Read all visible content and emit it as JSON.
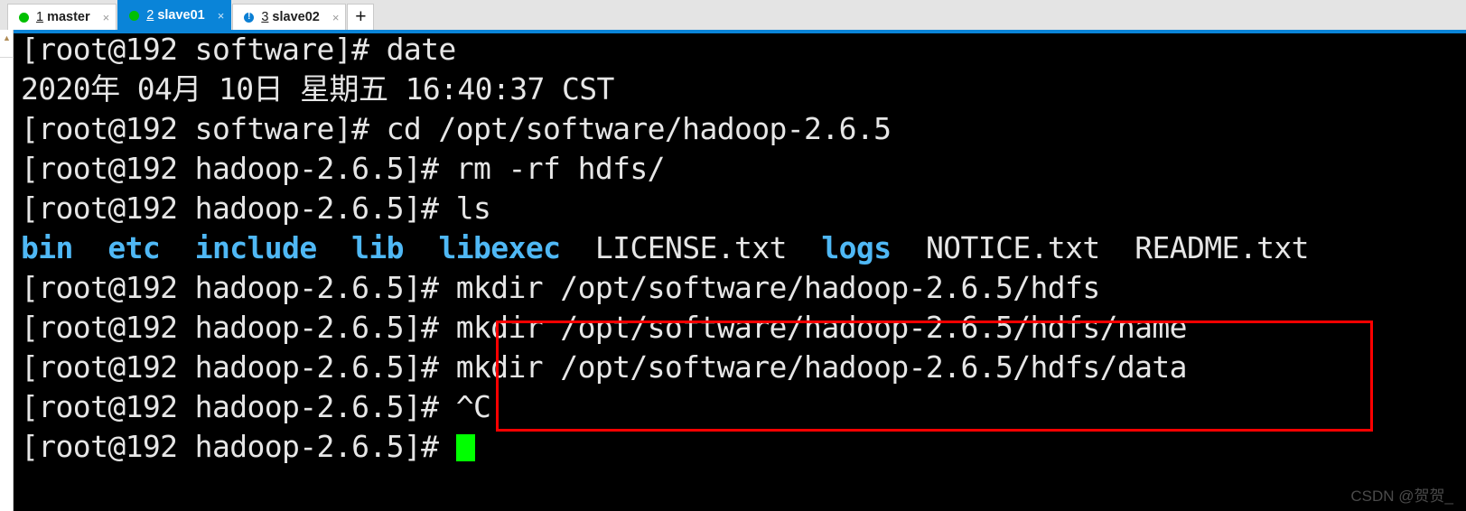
{
  "tabbar": {
    "tabs": [
      {
        "num": "1",
        "label": "master",
        "status_icon": "green-dot-icon",
        "close_icon": "×",
        "active": false
      },
      {
        "num": "2",
        "label": "slave01",
        "status_icon": "green-dot-icon",
        "close_icon": "×",
        "active": true
      },
      {
        "num": "3",
        "label": "slave02",
        "status_icon": "blue-alert-icon",
        "close_icon": "×",
        "active": false
      }
    ],
    "add_tab_label": "+",
    "active_tab_color": "#0a84d8",
    "status_ok_color": "#00c000",
    "status_alert_color": "#0b7fd4"
  },
  "scrollbar": {
    "up_arrow_icon": "▲"
  },
  "terminal": {
    "background": "#000000",
    "foreground": "#e6e6e6",
    "dir_color": "#4fb8f5",
    "cursor_color": "#00ff00",
    "lines": [
      {
        "text": "[root@192 software]# date"
      },
      {
        "text": "2020年 04月 10日 星期五 16:40:37 CST"
      },
      {
        "text": "[root@192 software]# cd /opt/software/hadoop-2.6.5"
      },
      {
        "text": "[root@192 hadoop-2.6.5]# rm -rf hdfs/"
      },
      {
        "text": "[root@192 hadoop-2.6.5]# ls"
      },
      {
        "segments": [
          {
            "text": "bin",
            "kind": "dir"
          },
          {
            "text": "  ",
            "kind": "plain"
          },
          {
            "text": "etc",
            "kind": "dir"
          },
          {
            "text": "  ",
            "kind": "plain"
          },
          {
            "text": "include",
            "kind": "dir"
          },
          {
            "text": "  ",
            "kind": "plain"
          },
          {
            "text": "lib",
            "kind": "dir"
          },
          {
            "text": "  ",
            "kind": "plain"
          },
          {
            "text": "libexec",
            "kind": "dir"
          },
          {
            "text": "  LICENSE.txt  ",
            "kind": "plain"
          },
          {
            "text": "logs",
            "kind": "dir"
          },
          {
            "text": "  NOTICE.txt  README.txt",
            "kind": "plain"
          }
        ]
      },
      {
        "text": "[root@192 hadoop-2.6.5]# mkdir /opt/software/hadoop-2.6.5/hdfs"
      },
      {
        "text": "[root@192 hadoop-2.6.5]# mkdir /opt/software/hadoop-2.6.5/hdfs/name"
      },
      {
        "text": "[root@192 hadoop-2.6.5]# mkdir /opt/software/hadoop-2.6.5/hdfs/data"
      },
      {
        "text": "[root@192 hadoop-2.6.5]# ^C"
      },
      {
        "text": "[root@192 hadoop-2.6.5]# ",
        "cursor": true
      }
    ]
  },
  "annotation": {
    "color": "#ff0000",
    "highlighted_commands": [
      "mkdir /opt/software/hadoop-2.6.5/hdfs",
      "mkdir /opt/software/hadoop-2.6.5/hdfs/name",
      "mkdir /opt/software/hadoop-2.6.5/hdfs/data"
    ]
  },
  "watermark": {
    "text": "CSDN @贺贺_"
  }
}
